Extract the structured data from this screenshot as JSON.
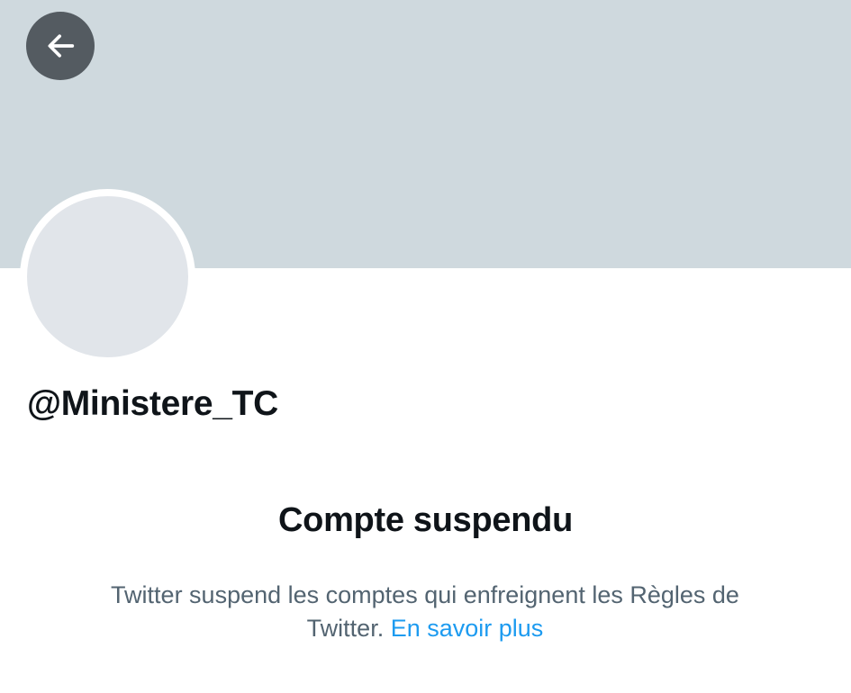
{
  "header": {
    "back_icon": "arrow-left-icon",
    "banner_color": "#cfd9de"
  },
  "profile": {
    "handle": "@Ministere_TC",
    "avatar_color": "#e1e5ea"
  },
  "suspension": {
    "title": "Compte suspendu",
    "message": "Twitter suspend les comptes qui enfreignent les Règles de Twitter.",
    "link_label": "En savoir plus"
  },
  "colors": {
    "accent": "#1d9bf0",
    "primary_text": "#0f1419",
    "secondary_text": "#536471",
    "back_button_bg": "#545b61"
  }
}
